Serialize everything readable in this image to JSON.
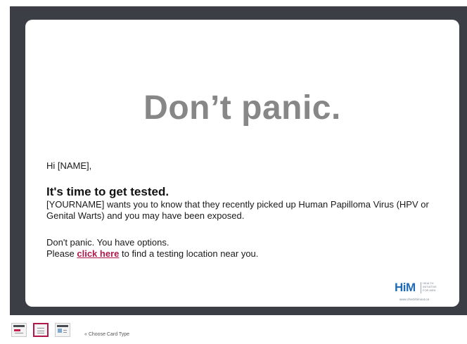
{
  "card": {
    "headline": "Don’t panic.",
    "greeting": "Hi [NAME],",
    "subheading": "It's time to get tested.",
    "body": "[YOURNAME] wants you to know that they recently picked up Human Papilloma Virus (HPV or Genital Warts) and you may have been exposed.",
    "options_line": "Don't panic. You have options.",
    "cta_prefix": "Please ",
    "cta_link": "click here",
    "cta_suffix": " to find a testing location near you.",
    "link_color": "#b0174b"
  },
  "logo": {
    "mark": "HiM",
    "words": [
      "HEALTH",
      "INITIATIVE",
      "FOR MEN"
    ],
    "url": "www.checkhimout.ca",
    "color": "#1f6bb5"
  },
  "card_type_selector": {
    "label": "« Choose Card Type",
    "options": [
      "card-type-1",
      "card-type-2",
      "card-type-3"
    ],
    "selected_index": 1
  },
  "colors": {
    "frame": "#3b3e44",
    "headline": "#878787",
    "accent": "#b0174b"
  }
}
